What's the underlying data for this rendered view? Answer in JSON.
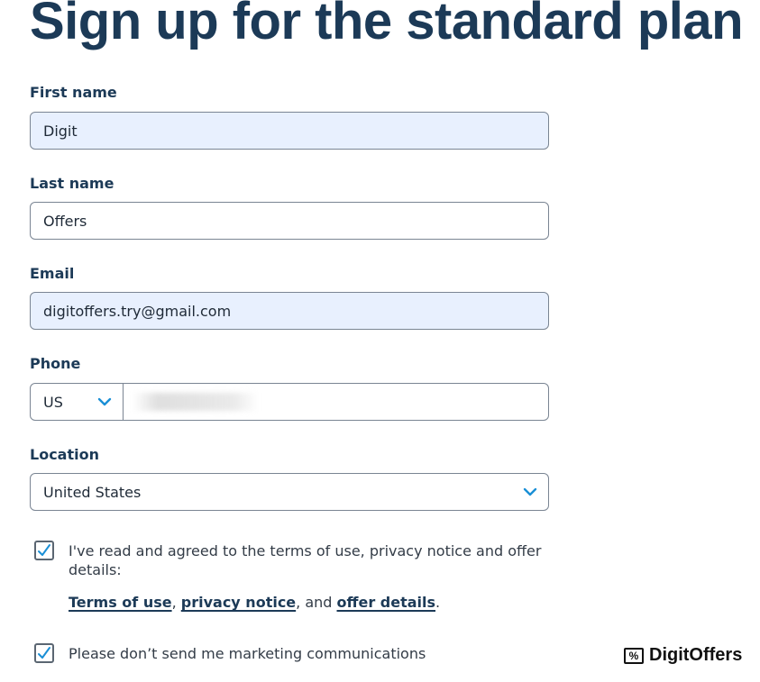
{
  "page": {
    "title": "Sign up for the standard plan"
  },
  "form": {
    "first_name": {
      "label": "First name",
      "value": "Digit"
    },
    "last_name": {
      "label": "Last name",
      "value": "Offers"
    },
    "email": {
      "label": "Email",
      "value": "digitoffers.try@gmail.com"
    },
    "phone": {
      "label": "Phone",
      "country_code": "US",
      "number": ""
    },
    "location": {
      "label": "Location",
      "value": "United States"
    }
  },
  "checkboxes": {
    "terms": {
      "checked": true,
      "line1": "I've read and agreed to the terms of use, privacy notice and offer",
      "line2": "details:"
    },
    "marketing": {
      "checked": true,
      "text": "Please don’t send me marketing communications"
    }
  },
  "links": {
    "terms_of_use": "Terms of use",
    "sep1": ", ",
    "privacy_notice": "privacy notice",
    "sep2": ", and ",
    "offer_details": "offer details",
    "end": "."
  },
  "watermark": {
    "brand": "DigitOffers",
    "icon": "percent-icon"
  },
  "colors": {
    "heading": "#1c3a57",
    "autofill_bg": "#e8f0fe",
    "check_accent": "#1a8fd6",
    "chevron": "#1a8fd6"
  }
}
